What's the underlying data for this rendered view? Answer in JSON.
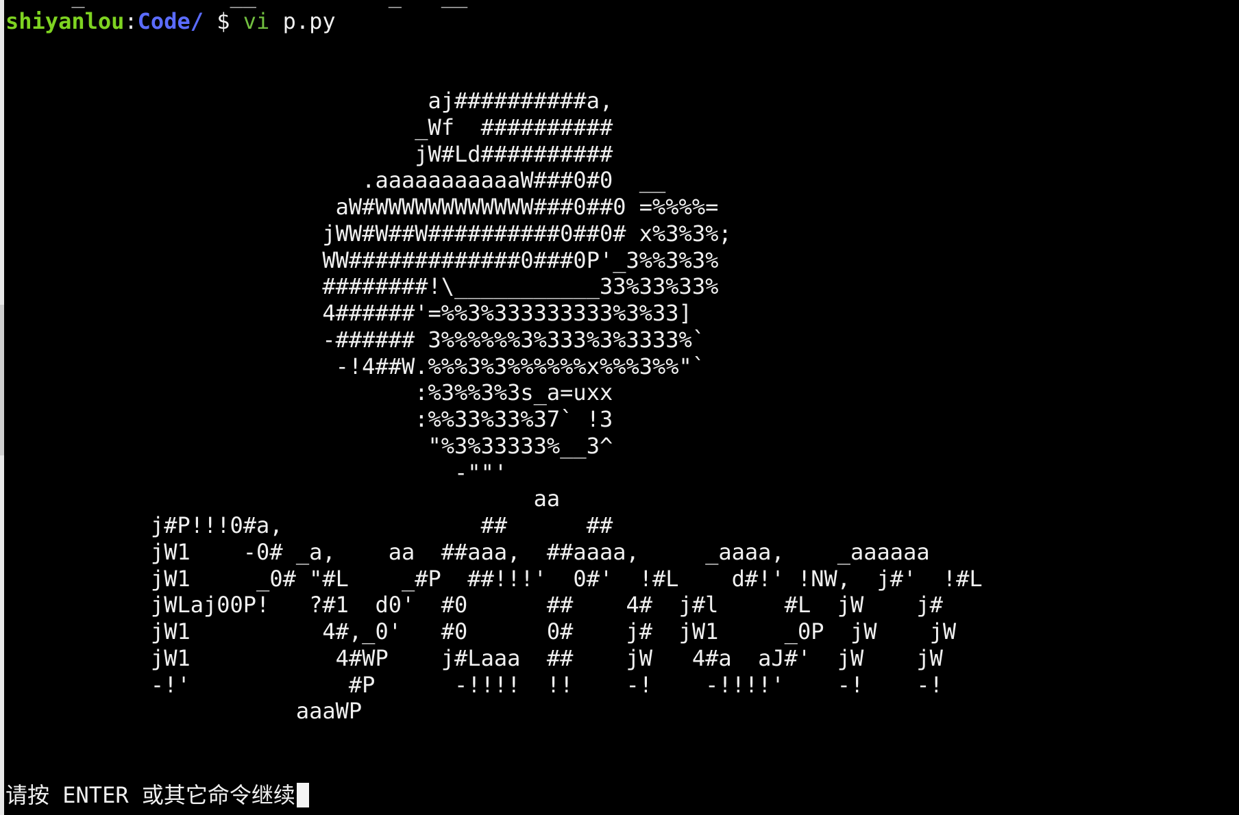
{
  "terminal": {
    "top_partial_line": "  `  _  `        __`   `     _  `__ ",
    "prompt": {
      "user": "shiyanlou",
      "separator": ":",
      "directory": "Code/",
      "symbol": "$",
      "command": "vi",
      "argument": "p.py"
    },
    "ascii_art": "                                aj##########a,\n                               _Wf  ##########\n                               jW#Ld##########\n                           .aaaaaaaaaaaW###0#0  __\n                         aW#WWWWWWWWWWWW###0##0 =%%%%=\n                        jWW#W##W##########0##0# x%3%3%;\n                        WW#############0###0P'_3%%3%3%\n                        ########!\\___________33%33%33%\n                        4######'=%%3%333333333%3%33]\n                        -###### 3%%%%%%3%333%3%3333%`\n                         -!4##W.%%%3%3%%%%%%x%%%3%%\"`\n                               :%3%%3%3s_a=uxx\n                               :%%33%33%37` !3\n                                \"%3%33333%__3^\n                                  -\"\"'\n                                        aa\n           j#P!!!0#a,               ##      ##\n           jW1    -0# _a,    aa  ##aaa,  ##aaaa,     _aaaa,    _aaaaaa\n           jW1     _0# \"#L    _#P  ##!!!'  0#'  !#L    d#!' !NW,  j#'  !#L\n           jWLaj00P!   ?#1  d0'  #0      ##    4#  j#l     #L  jW    j#\n           jW1          4#,_0'   #0      0#    j#  jW1     _0P  jW    jW\n           jW1           4#WP    j#Laaa  ##    jW   4#a  aJ#'  jW    jW\n           -!'            #P      -!!!!  !!    -!    -!!!!'    -!    -!\n                      aaaWP",
    "status_message": "请按 ENTER 或其它命令继续"
  }
}
